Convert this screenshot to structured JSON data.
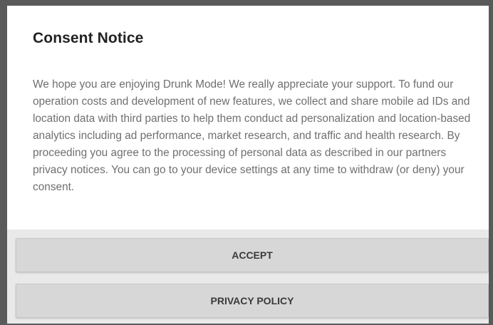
{
  "dialog": {
    "title": "Consent Notice",
    "message": "We hope you are enjoying Drunk Mode! We really appreciate your support. To fund our operation costs and development of new features, we collect and share mobile ad IDs and location data with third parties to help them conduct ad personalization and location-based analytics including ad performance, market research, and traffic and health research. By proceeding you agree to the processing of personal data as described in our partners privacy notices. You can go to your device settings at any time to withdraw (or deny) your consent."
  },
  "buttons": {
    "accept_label": "ACCEPT",
    "privacy_label": "PRIVACY POLICY"
  },
  "colors": {
    "backdrop": "#5a5a5a",
    "dialog_bg": "#ffffff",
    "button_bg": "#d7d7d7",
    "title_text": "#222222",
    "body_text": "#6f6f6f"
  }
}
